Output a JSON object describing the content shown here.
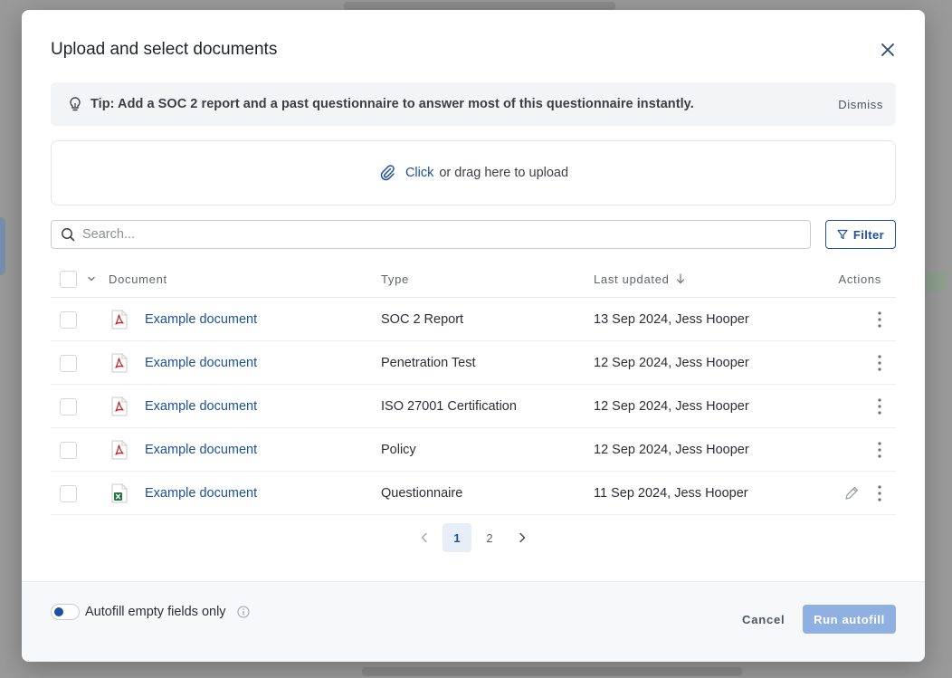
{
  "modal": {
    "title": "Upload and select documents"
  },
  "tip": {
    "text": "Tip: Add a SOC 2 report and a past questionnaire to answer most of this questionnaire instantly.",
    "dismiss_label": "Dismiss"
  },
  "upload": {
    "click_label": "Click",
    "rest_label": "or drag here to upload"
  },
  "search": {
    "placeholder": "Search...",
    "value": ""
  },
  "filter": {
    "label": "Filter"
  },
  "table": {
    "headers": {
      "document": "Document",
      "type": "Type",
      "last_updated": "Last updated",
      "actions": "Actions"
    },
    "rows": [
      {
        "name": "Example document",
        "type": "SOC 2 Report",
        "updated": "13 Sep 2024, Jess Hooper",
        "file_icon": "pdf-file-icon",
        "editable": false
      },
      {
        "name": "Example document",
        "type": "Penetration Test",
        "updated": "12 Sep 2024, Jess Hooper",
        "file_icon": "pdf-file-icon",
        "editable": false
      },
      {
        "name": "Example document",
        "type": "ISO 27001 Certification",
        "updated": "12 Sep 2024, Jess Hooper",
        "file_icon": "pdf-file-icon",
        "editable": false
      },
      {
        "name": "Example document",
        "type": "Policy",
        "updated": "12 Sep 2024, Jess Hooper",
        "file_icon": "pdf-file-icon",
        "editable": false
      },
      {
        "name": "Example document",
        "type": "Questionnaire",
        "updated": "11 Sep 2024, Jess Hooper",
        "file_icon": "excel-file-icon",
        "editable": true
      }
    ]
  },
  "pagination": {
    "pages": [
      "1",
      "2"
    ],
    "current": "1"
  },
  "footer": {
    "toggle_label": "Autofill empty fields only",
    "toggle_on": true,
    "cancel_label": "Cancel",
    "run_label": "Run autofill"
  },
  "colors": {
    "accent": "#1e4fa0",
    "run_button_disabled": "#8fb0e0",
    "pdf_red": "#c62828",
    "excel_green": "#1d7a3e"
  }
}
